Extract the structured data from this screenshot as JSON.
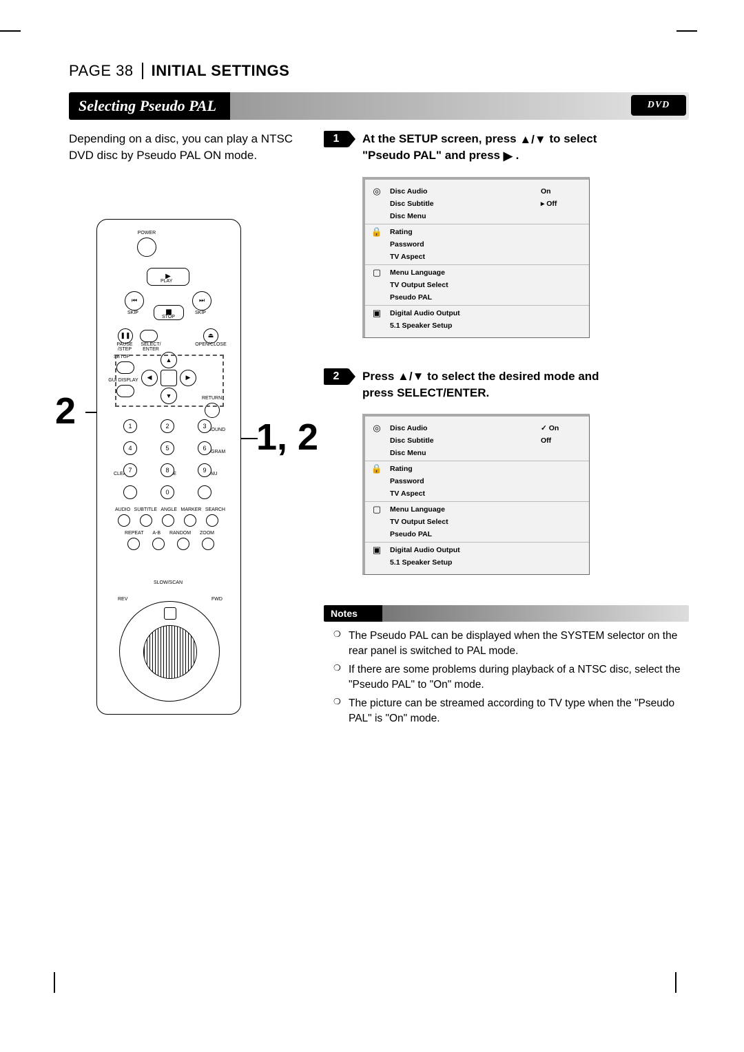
{
  "header": {
    "page_label": "PAGE 38",
    "section": "INITIAL SETTINGS"
  },
  "title_bar": {
    "title": "Selecting Pseudo PAL",
    "dvd_badge": "DVD"
  },
  "intro": "Depending on a disc, you can play a NTSC DVD disc by Pseudo PAL ON mode.",
  "callouts": {
    "left": "2",
    "right": "1, 2"
  },
  "remote": {
    "labels": {
      "power": "POWER",
      "play": "PLAY",
      "skip_l": "SKIP",
      "skip_r": "SKIP",
      "stop": "STOP",
      "pause": "PAUSE /STEP",
      "select_enter": "SELECT/ ENTER",
      "open_close": "OPEN/CLOSE",
      "setup": "SETUP",
      "gui": "GUI DISPLAY",
      "return": "RETURN",
      "3d": "3D SOUND",
      "program": "PROGRAM",
      "clear": "CLEAR",
      "title": "TITLE",
      "menu": "MENU",
      "row_top": [
        "AUDIO",
        "SUBTITLE",
        "ANGLE",
        "MARKER",
        "SEARCH"
      ],
      "row_mid": [
        "REPEAT",
        "A-B",
        "RANDOM",
        "ZOOM"
      ],
      "slow": "SLOW/SCAN",
      "rev": "REV",
      "fwd": "FWD"
    }
  },
  "steps": {
    "s1": {
      "num": "1",
      "line1_a": "At the SETUP screen, press ",
      "line1_b": " to select",
      "line2_a": "\"Pseudo PAL\" and press ",
      "line2_b": "."
    },
    "s2": {
      "num": "2",
      "line1_a": "Press ",
      "line1_b": " to select the desired mode and",
      "line2": "press SELECT/ENTER."
    }
  },
  "osd": {
    "items": [
      "Disc Audio",
      "Disc Subtitle",
      "Disc Menu",
      "Rating",
      "Password",
      "TV Aspect",
      "Menu Language",
      "TV Output Select",
      "Pseudo PAL",
      "Digital Audio Output",
      "5.1 Speaker Setup"
    ],
    "vals1": {
      "on": "On",
      "off": "▸ Off"
    },
    "vals2": {
      "on": "✓ On",
      "off": "Off"
    }
  },
  "notes": {
    "heading": "Notes",
    "items": [
      "The Pseudo PAL can be displayed when the SYSTEM selector on the rear panel is switched to PAL mode.",
      "If there are some problems during playback of a NTSC disc, select the \"Pseudo PAL\" to \"On\" mode.",
      "The picture can be streamed according to TV type when the \"Pseudo PAL\" is \"On\" mode."
    ]
  }
}
